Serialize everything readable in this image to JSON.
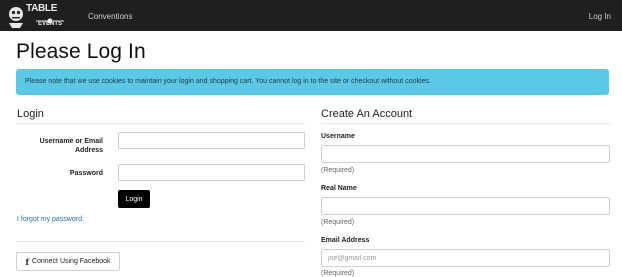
{
  "nav": {
    "logo_word_table": "TABLE",
    "logo_word_events": "EVENTS",
    "conventions": "Conventions",
    "login": "Log In"
  },
  "page": {
    "title": "Please Log In",
    "alert": "Please note that we use cookies to maintain your login and shopping cart. You cannot log in to the site or checkout without cookies."
  },
  "login": {
    "heading": "Login",
    "username_label_line1": "Username or Email",
    "username_label_line2": "Address",
    "username_value": "",
    "password_label": "Password",
    "password_value": "",
    "submit": "Login",
    "forgot": "I forgot my password.",
    "facebook": "Connect Using Facebook",
    "facebook_glyph": "f"
  },
  "create": {
    "heading": "Create An Account",
    "username_label": "Username",
    "username_value": "",
    "username_help": "(Required)",
    "realname_label": "Real Name",
    "realname_value": "",
    "realname_help": "(Required)",
    "email_label": "Email Address",
    "email_placeholder": "joe@gmail.com",
    "email_help": "(Required)"
  },
  "colors": {
    "navbar": "#1f1f1f",
    "alert": "#5bc8e6",
    "link": "#2a6fb0"
  }
}
